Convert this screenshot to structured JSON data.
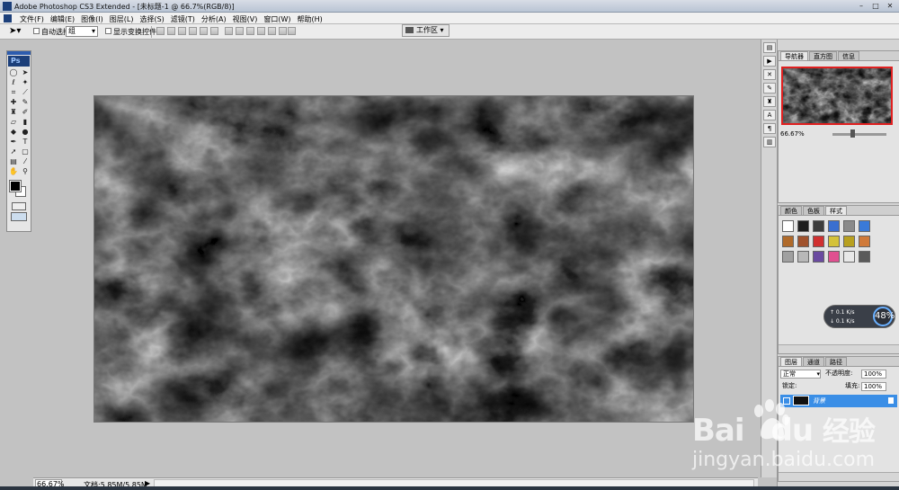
{
  "window": {
    "title": "Adobe Photoshop CS3 Extended - [未标题-1 @ 66.7%(RGB/8)]",
    "min_glyph": "–",
    "max_glyph": "□",
    "close_glyph": "✕"
  },
  "menu": [
    "文件(F)",
    "编辑(E)",
    "图像(I)",
    "图层(L)",
    "选择(S)",
    "滤镜(T)",
    "分析(A)",
    "视图(V)",
    "窗口(W)",
    "帮助(H)"
  ],
  "options": {
    "auto_select_label": "自动选择:",
    "auto_select_value": "组",
    "show_transform_label": "显示变换控件",
    "workspace_label": "工作区 ▾"
  },
  "toolbox": {
    "logo": "Ps"
  },
  "status": {
    "zoom": "66.67%",
    "doc": "文档:5.85M/5.85M",
    "arrow": "▶"
  },
  "navigator": {
    "tabs": [
      "导航器",
      "直方图",
      "信息"
    ],
    "zoom": "66.67%"
  },
  "swatches_panel": {
    "tabs": [
      "颜色",
      "色板",
      "样式"
    ]
  },
  "swatches": [
    "#ffffff",
    "#1e1e1e",
    "#3c3c3c",
    "#3a6fd0",
    "#8a8a8a",
    "#3a7ad8",
    "#b06a2a",
    "#a0522d",
    "#d03030",
    "#d4c23a",
    "#b8a020",
    "#d07a3a",
    "#a0a0a0",
    "#b8b8b8",
    "#6a4aa0",
    "#e05090",
    "#e8e8e8",
    "#5a5a5a"
  ],
  "speed_widget": {
    "up": "↑ 0.1 K/s",
    "down": "↓ 0.1 K/s",
    "percent": "48%"
  },
  "layers": {
    "tabs": [
      "图层",
      "通道",
      "路径"
    ],
    "blend": "正常",
    "opacity_label": "不透明度:",
    "opacity": "100%",
    "lock_label": "锁定:",
    "fill_label": "填充:",
    "fill": "100%",
    "layer_name": "背景"
  },
  "watermark": {
    "brand": "Bai",
    "brand_mid": "du",
    "brand_cn": "经验",
    "url": "jingyan.baidu.com"
  }
}
